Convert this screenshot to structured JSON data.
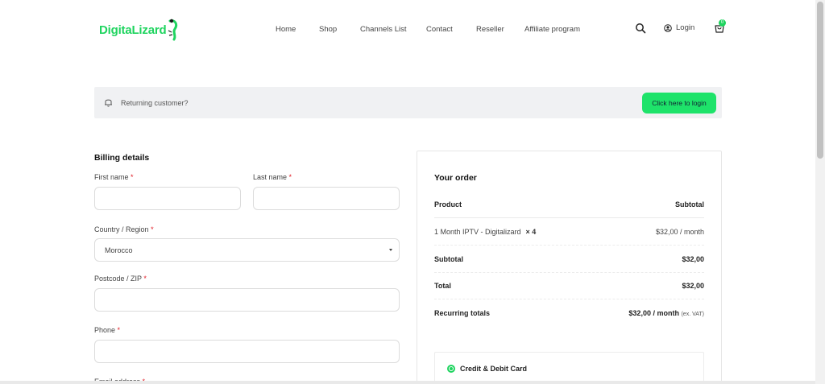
{
  "header": {
    "logo_part1": "Digita",
    "logo_part2": "Lizard",
    "nav": [
      "Home",
      "Shop",
      "Channels List",
      "Contact",
      "Reseller",
      "Affiliate program"
    ],
    "login_label": "Login",
    "cart_count": "0"
  },
  "banner": {
    "text": "Returning customer?",
    "button_label": "Click here to login"
  },
  "billing": {
    "title": "Billing details",
    "required_mark": "*",
    "first_name_label": "First name",
    "last_name_label": "Last name",
    "country_label": "Country / Region",
    "country_value": "Morocco",
    "postcode_label": "Postcode / ZIP",
    "phone_label": "Phone",
    "email_label": "Email address"
  },
  "order": {
    "title": "Your order",
    "col_product": "Product",
    "col_subtotal": "Subtotal",
    "item_name": "1 Month IPTV - Digitalizard",
    "item_qty": "× 4",
    "item_price": "$32,00 / month",
    "subtotal_label": "Subtotal",
    "subtotal_value": "$32,00",
    "total_label": "Total",
    "total_value": "$32,00",
    "recurring_label": "Recurring totals",
    "recurring_value": "$32,00 / month",
    "recurring_note": "(ex. VAT)"
  },
  "payment": {
    "method_label": "Credit & Debit Card"
  },
  "colors": {
    "accent": "#1fd45f",
    "button": "#1ee36a",
    "required": "#e01b24"
  }
}
